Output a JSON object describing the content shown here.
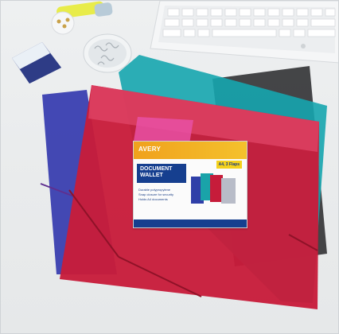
{
  "label": {
    "brand": "AVERY",
    "title_line1": "DOCUMENT",
    "title_line2": "WALLET",
    "badge": "A4, 3 Flaps",
    "bullets": [
      "Durable polypropylene",
      "Snap closure for security",
      "Holds A4 documents"
    ]
  },
  "colors": {
    "background": "#eceeef",
    "red_wallet": "#c61c3a",
    "blue_wallet": "#3a3fb0",
    "teal_wallet": "#17a6b0",
    "black_wallet": "#3b3b3d",
    "label_accent": "#f2ad22",
    "label_blue": "#163f8f"
  },
  "objects": [
    "keyboard",
    "highlighter",
    "paperclip-jar",
    "tape-dispenser",
    "document-wallets"
  ]
}
